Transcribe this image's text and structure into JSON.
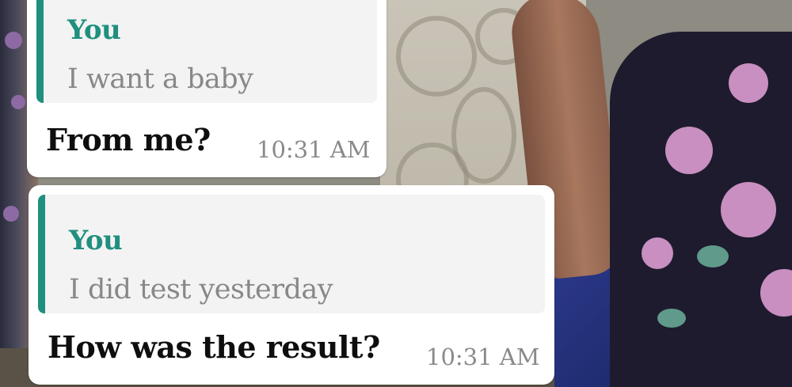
{
  "messages": [
    {
      "quoted": {
        "author": "You",
        "text": "I want a baby"
      },
      "text": "From me?",
      "time": "10:31 AM"
    },
    {
      "quoted": {
        "author": "You",
        "text": "I did test yesterday"
      },
      "text": "How was the result?",
      "time": "10:31 AM"
    }
  ],
  "colors": {
    "quote_accent": "#1f8f7e",
    "bubble": "#ffffff",
    "quote_background": "#f3f3f3",
    "timestamp": "#8a8a8a"
  }
}
